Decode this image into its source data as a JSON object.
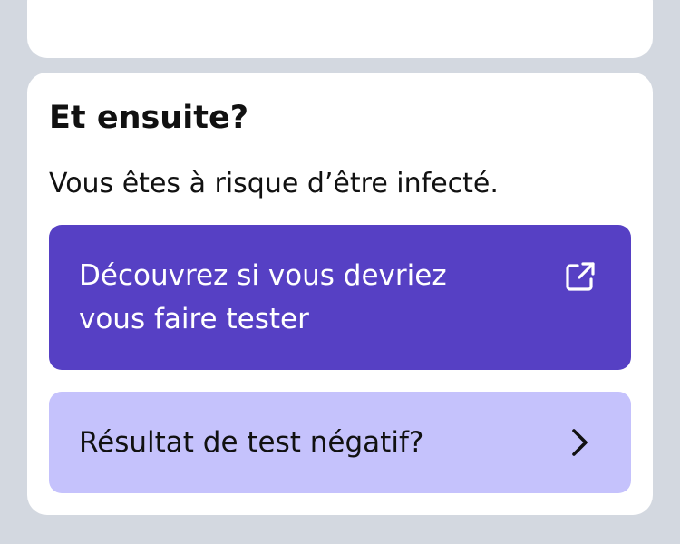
{
  "top_card": {},
  "next_steps": {
    "heading": "Et ensuite?",
    "description": "Vous êtes à risque d’être infecté.",
    "primary_button": {
      "label": "Découvrez si vous devriez vous faire tester",
      "icon": "external-link-icon"
    },
    "secondary_button": {
      "label": "Résultat de test négatif?",
      "icon": "chevron-right-icon"
    }
  },
  "colors": {
    "background": "#d3d8e0",
    "card": "#ffffff",
    "primary": "#5640c4",
    "secondary": "#c5c2fc",
    "text": "#111111"
  }
}
